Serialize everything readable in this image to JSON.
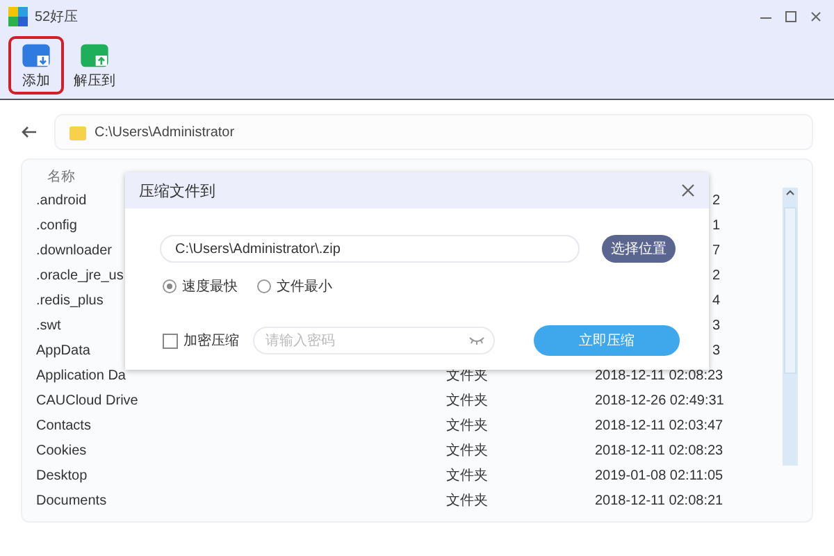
{
  "window": {
    "title": "52好压"
  },
  "toolbar": [
    {
      "kind": "add",
      "label": "添加",
      "selected": true
    },
    {
      "kind": "extract",
      "label": "解压到",
      "selected": false
    }
  ],
  "path_bar": {
    "path": "C:\\Users\\Administrator"
  },
  "file_list": {
    "columns": [
      "名称"
    ],
    "rows": [
      {
        "name": ".android",
        "modified": "2"
      },
      {
        "name": ".config",
        "modified": "1"
      },
      {
        "name": ".downloader",
        "modified": "7"
      },
      {
        "name": ".oracle_jre_us",
        "modified": "2"
      },
      {
        "name": ".redis_plus",
        "modified": "4"
      },
      {
        "name": ".swt",
        "modified": "3"
      },
      {
        "name": "AppData",
        "modified": "3"
      },
      {
        "name": "Application Da",
        "type": "文件夹",
        "modified": "2018-12-11 02:08:23"
      },
      {
        "name": "CAUCloud Drive",
        "type": "文件夹",
        "modified": "2018-12-26 02:49:31"
      },
      {
        "name": "Contacts",
        "type": "文件夹",
        "modified": "2018-12-11 02:03:47"
      },
      {
        "name": "Cookies",
        "type": "文件夹",
        "modified": "2018-12-11 02:08:23"
      },
      {
        "name": "Desktop",
        "type": "文件夹",
        "modified": "2019-01-08 02:11:05"
      },
      {
        "name": "Documents",
        "type": "文件夹",
        "modified": "2018-12-11 02:08:21"
      }
    ]
  },
  "dialog": {
    "title": "压缩文件到",
    "path_field": {
      "value": "C:\\Users\\Administrator\\.zip"
    },
    "browse_button": "选择位置",
    "options": [
      {
        "label": "速度最快",
        "selected": true
      },
      {
        "label": "文件最小",
        "selected": false
      }
    ],
    "encrypt": {
      "label": "加密压缩",
      "checked": false
    },
    "password": {
      "placeholder": "请输入密码"
    },
    "compress_button": "立即压缩"
  }
}
